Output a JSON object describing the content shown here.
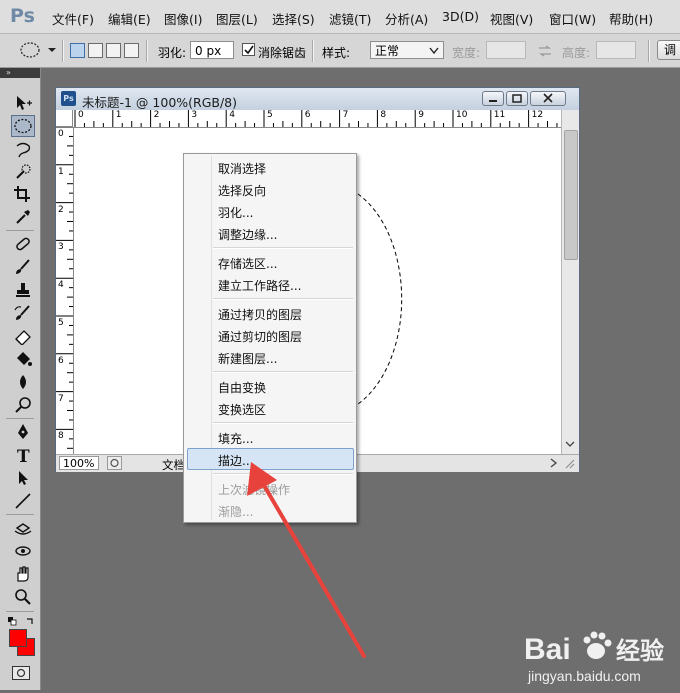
{
  "app": {
    "logo": "Ps"
  },
  "menubar": {
    "items": [
      "文件(F)",
      "编辑(E)",
      "图像(I)",
      "图层(L)",
      "选择(S)",
      "滤镜(T)",
      "分析(A)",
      "3D(D)",
      "视图(V)",
      "窗口(W)",
      "帮助(H)"
    ]
  },
  "options": {
    "feather_label": "羽化:",
    "feather_value": "0 px",
    "antialias_label": "消除锯齿",
    "antialias_checked": true,
    "style_label": "样式:",
    "style_value": "正常",
    "width_label": "宽度:",
    "height_label": "高度:",
    "refine_button": "调"
  },
  "toolbox": {
    "header": "»",
    "tools": [
      "move-tool",
      "elliptical-marquee-tool",
      "lasso-tool",
      "quick-selection-tool",
      "crop-tool",
      "eyedropper-tool",
      "spot-healing-brush-tool",
      "brush-tool",
      "clone-stamp-tool",
      "history-brush-tool",
      "eraser-tool",
      "paint-bucket-tool",
      "blur-tool",
      "dodge-tool",
      "pen-tool",
      "type-tool",
      "path-selection-tool",
      "line-tool",
      "3d-rotate-tool",
      "3d-orbit-tool",
      "hand-tool",
      "zoom-tool"
    ],
    "foreground_color": "#ff0000",
    "background_color": "#ff0000"
  },
  "document": {
    "icon": "Ps",
    "title": "未标题-1 @ 100%(RGB/8)",
    "ruler_top": [
      "0",
      "1",
      "2",
      "3",
      "4",
      "5",
      "6",
      "7",
      "8",
      "9",
      "10",
      "11",
      "12"
    ],
    "ruler_left": [
      "0",
      "1",
      "2",
      "3",
      "4",
      "5",
      "6",
      "7",
      "8"
    ],
    "zoom": "100%",
    "info": "文档"
  },
  "context_menu": {
    "items": [
      "取消选择",
      "选择反向",
      "羽化...",
      "调整边缘...",
      "存储选区...",
      "建立工作路径...",
      "通过拷贝的图层",
      "通过剪切的图层",
      "新建图层...",
      "自由变换",
      "变换选区",
      "填充...",
      "描边...",
      "上次滤镜操作",
      "渐隐..."
    ],
    "highlighted": "描边...",
    "disabled": [
      "上次滤镜操作",
      "渐隐..."
    ]
  },
  "annotation": {
    "arrow_color": "#e8423c"
  },
  "watermark": {
    "brand": "Bai",
    "brand2": "经验",
    "url": "jingyan.baidu.com"
  }
}
